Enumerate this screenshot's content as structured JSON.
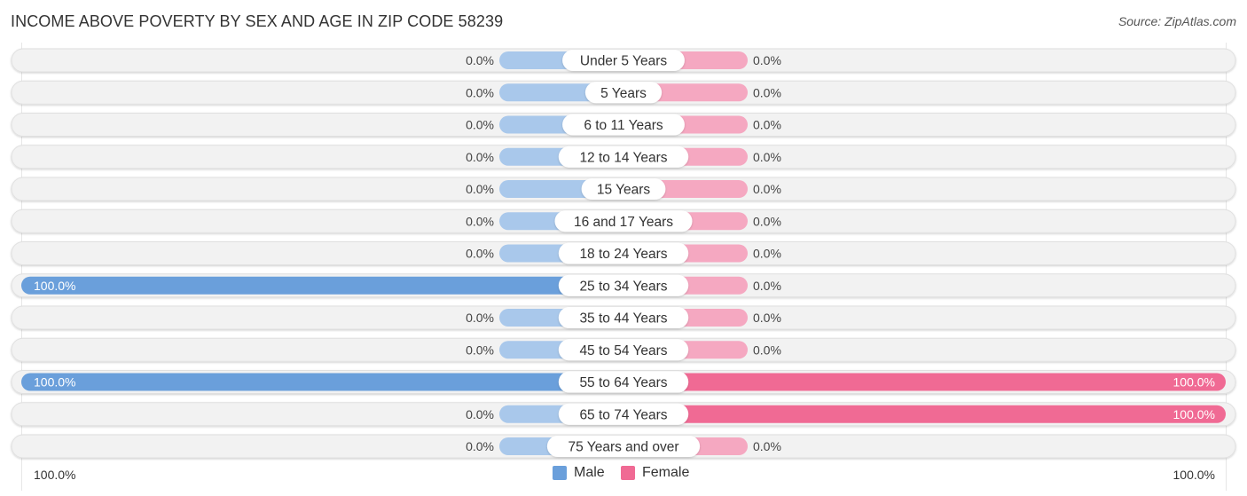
{
  "title": "INCOME ABOVE POVERTY BY SEX AND AGE IN ZIP CODE 58239",
  "source": "Source: ZipAtlas.com",
  "colors": {
    "male": "#6a9fdb",
    "male_light": "#a9c8eb",
    "female": "#f06a94",
    "female_light": "#f5a8c1",
    "row_bg": "#f2f2f2"
  },
  "axis": {
    "left_label": "100.0%",
    "right_label": "100.0%"
  },
  "legend": [
    {
      "name": "Male",
      "color": "#6a9fdb"
    },
    {
      "name": "Female",
      "color": "#f06a94"
    }
  ],
  "chart_data": {
    "type": "bar",
    "orientation": "horizontal-diverging",
    "title": "INCOME ABOVE POVERTY BY SEX AND AGE IN ZIP CODE 58239",
    "categories": [
      "Under 5 Years",
      "5 Years",
      "6 to 11 Years",
      "12 to 14 Years",
      "15 Years",
      "16 and 17 Years",
      "18 to 24 Years",
      "25 to 34 Years",
      "35 to 44 Years",
      "45 to 54 Years",
      "55 to 64 Years",
      "65 to 74 Years",
      "75 Years and over"
    ],
    "series": [
      {
        "name": "Male",
        "values": [
          0,
          0,
          0,
          0,
          0,
          0,
          0,
          100,
          0,
          0,
          100,
          0,
          0
        ],
        "labels": [
          "0.0%",
          "0.0%",
          "0.0%",
          "0.0%",
          "0.0%",
          "0.0%",
          "0.0%",
          "100.0%",
          "0.0%",
          "0.0%",
          "100.0%",
          "0.0%",
          "0.0%"
        ]
      },
      {
        "name": "Female",
        "values": [
          0,
          0,
          0,
          0,
          0,
          0,
          0,
          0,
          0,
          0,
          100,
          100,
          0
        ],
        "labels": [
          "0.0%",
          "0.0%",
          "0.0%",
          "0.0%",
          "0.0%",
          "0.0%",
          "0.0%",
          "0.0%",
          "0.0%",
          "0.0%",
          "100.0%",
          "100.0%",
          "0.0%"
        ]
      }
    ],
    "xlim": [
      0,
      100
    ],
    "xlabel_left": "100.0%",
    "xlabel_right": "100.0%",
    "legend_position": "bottom-center"
  }
}
